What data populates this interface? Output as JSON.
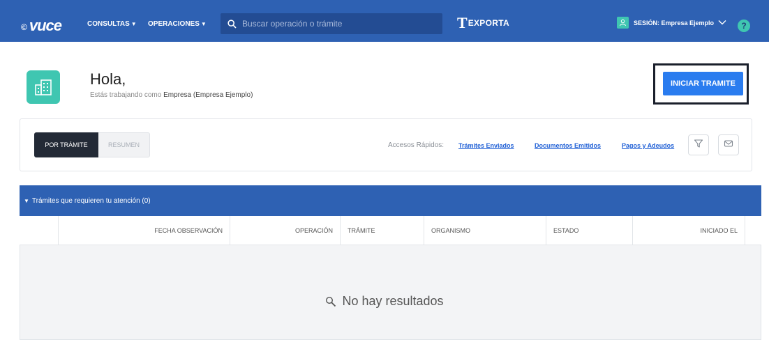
{
  "header": {
    "logo_mark": "©",
    "logo_text": "vuce",
    "nav": [
      {
        "label": "CONSULTAS",
        "caret": "▼"
      },
      {
        "label": "OPERACIONES",
        "caret": "▼"
      }
    ],
    "search_placeholder": "Buscar operación o trámite",
    "exporta_t": "T",
    "exporta_word": "EXPORTA",
    "session_label": "SESIÓN: Empresa Ejemplo",
    "help_label": "?"
  },
  "greeting": {
    "hello": "Hola,",
    "working_prefix": "Estás trabajando como ",
    "working_entity": "Empresa (Empresa Ejemplo)",
    "cta_label": "INICIAR TRAMITE"
  },
  "filters": {
    "tab_active": "POR TRÁMITE",
    "tab_inactive": "RESUMEN",
    "quick_label": "Accesos Rápidos:",
    "quick_links": [
      "Trámites Enviados",
      "Documentos Emitidos",
      "Pagos y Adeudos"
    ]
  },
  "panel": {
    "title": "Trámites que requieren tu atención (0)",
    "columns": [
      "FECHA OBSERVACIÓN",
      "OPERACIÓN",
      "TRÁMITE",
      "ORGANISMO",
      "ESTADO",
      "INICIADO EL"
    ],
    "empty_text": "No hay resultados"
  },
  "colors": {
    "brand_blue": "#2e61b3",
    "accent_teal": "#3fc6b1",
    "cta_blue": "#2a7cef",
    "link_blue": "#2060d6"
  }
}
